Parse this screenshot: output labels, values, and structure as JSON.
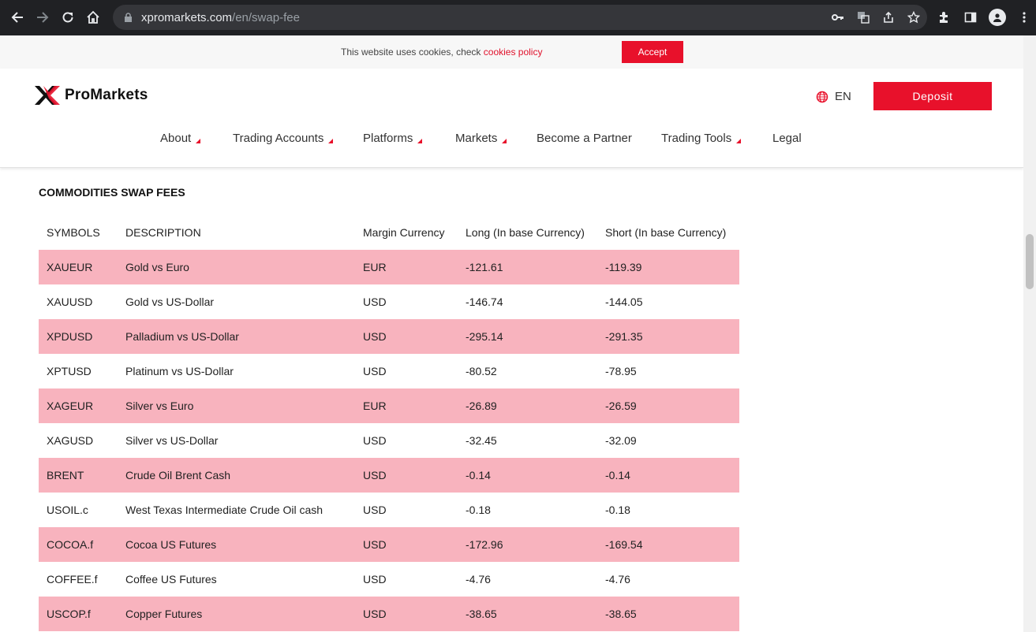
{
  "browser": {
    "url_host": "xpromarkets.com",
    "url_path": "/en/swap-fee"
  },
  "cookie": {
    "text": "This website uses cookies, check",
    "link": "cookies policy",
    "accept": "Accept"
  },
  "header": {
    "brand": "ProMarkets",
    "lang": "EN",
    "deposit": "Deposit"
  },
  "menu": [
    {
      "label": "About",
      "caret": true
    },
    {
      "label": "Trading Accounts",
      "caret": true
    },
    {
      "label": "Platforms",
      "caret": true
    },
    {
      "label": "Markets",
      "caret": true
    },
    {
      "label": "Become a Partner",
      "caret": false
    },
    {
      "label": "Trading Tools",
      "caret": true
    },
    {
      "label": "Legal",
      "caret": false
    }
  ],
  "section": {
    "title": "COMMODITIES SWAP FEES"
  },
  "table": {
    "headers": [
      "SYMBOLS",
      "DESCRIPTION",
      "Margin Currency",
      "Long (In base Currency)",
      "Short (In base Currency)"
    ],
    "rows": [
      [
        "XAUEUR",
        "Gold vs Euro",
        "EUR",
        "-121.61",
        "-119.39"
      ],
      [
        "XAUUSD",
        "Gold vs US-Dollar",
        "USD",
        "-146.74",
        "-144.05"
      ],
      [
        "XPDUSD",
        "Palladium vs US-Dollar",
        "USD",
        "-295.14",
        "-291.35"
      ],
      [
        "XPTUSD",
        "Platinum vs US-Dollar",
        "USD",
        "-80.52",
        "-78.95"
      ],
      [
        "XAGEUR",
        "Silver vs Euro",
        "EUR",
        "-26.89",
        "-26.59"
      ],
      [
        "XAGUSD",
        "Silver vs US-Dollar",
        "USD",
        "-32.45",
        "-32.09"
      ],
      [
        "BRENT",
        "Crude Oil Brent Cash",
        "USD",
        "-0.14",
        "-0.14"
      ],
      [
        "USOIL.c",
        "West Texas Intermediate Crude Oil cash",
        "USD",
        "-0.18",
        "-0.18"
      ],
      [
        "COCOA.f",
        "Cocoa US Futures",
        "USD",
        "-172.96",
        "-169.54"
      ],
      [
        "COFFEE.f",
        "Coffee US Futures",
        "USD",
        "-4.76",
        "-4.76"
      ],
      [
        "USCOP.f",
        "Copper Futures",
        "USD",
        "-38.65",
        "-38.65"
      ]
    ]
  },
  "colors": {
    "accent": "#e8112b",
    "row_highlight": "#f8b3be"
  }
}
